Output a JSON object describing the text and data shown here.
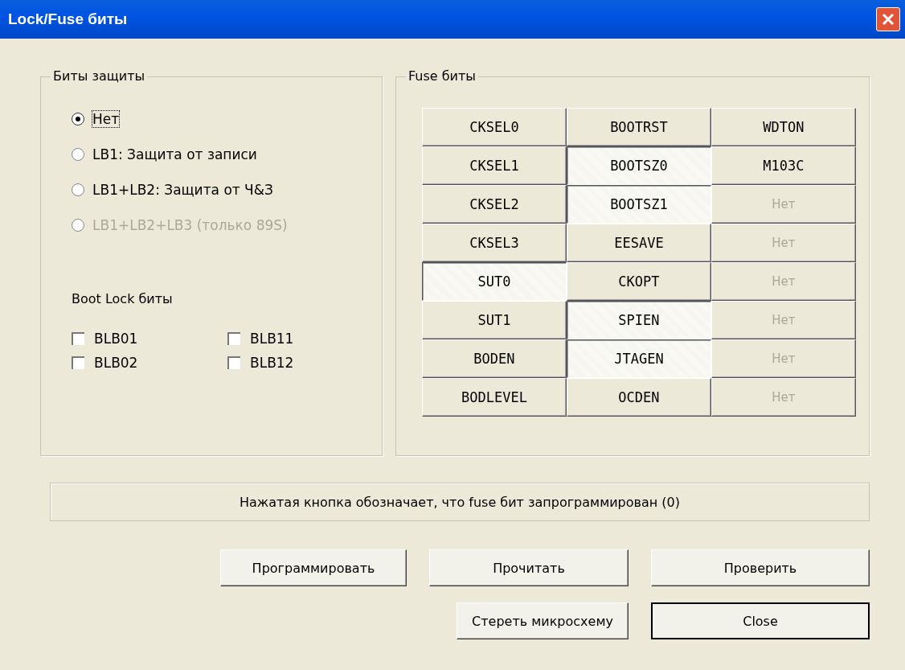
{
  "window": {
    "title": "Lock/Fuse биты"
  },
  "lock_group": {
    "title": "Биты защиты",
    "options": [
      {
        "label": "Нет",
        "selected": true,
        "disabled": false
      },
      {
        "label": "LB1: Защита от записи",
        "selected": false,
        "disabled": false
      },
      {
        "label": "LB1+LB2: Защита от Ч&З",
        "selected": false,
        "disabled": false
      },
      {
        "label": "LB1+LB2+LB3 (только 89S)",
        "selected": false,
        "disabled": true
      }
    ],
    "boot_lock_label": "Boot Lock биты",
    "boot_lock_bits": [
      {
        "label": "BLB01",
        "checked": false
      },
      {
        "label": "BLB11",
        "checked": false
      },
      {
        "label": "BLB02",
        "checked": false
      },
      {
        "label": "BLB12",
        "checked": false
      }
    ]
  },
  "fuse_group": {
    "title": "Fuse биты",
    "buttons": [
      {
        "label": "CKSEL0",
        "pressed": false,
        "disabled": false
      },
      {
        "label": "BOOTRST",
        "pressed": false,
        "disabled": false
      },
      {
        "label": "WDTON",
        "pressed": false,
        "disabled": false
      },
      {
        "label": "CKSEL1",
        "pressed": false,
        "disabled": false
      },
      {
        "label": "BOOTSZ0",
        "pressed": true,
        "disabled": false
      },
      {
        "label": "M103C",
        "pressed": false,
        "disabled": false
      },
      {
        "label": "CKSEL2",
        "pressed": false,
        "disabled": false
      },
      {
        "label": "BOOTSZ1",
        "pressed": true,
        "disabled": false
      },
      {
        "label": "Нет",
        "pressed": false,
        "disabled": true
      },
      {
        "label": "CKSEL3",
        "pressed": false,
        "disabled": false
      },
      {
        "label": "EESAVE",
        "pressed": false,
        "disabled": false
      },
      {
        "label": "Нет",
        "pressed": false,
        "disabled": true
      },
      {
        "label": "SUT0",
        "pressed": true,
        "disabled": false
      },
      {
        "label": "CKOPT",
        "pressed": false,
        "disabled": false
      },
      {
        "label": "Нет",
        "pressed": false,
        "disabled": true
      },
      {
        "label": "SUT1",
        "pressed": false,
        "disabled": false
      },
      {
        "label": "SPIEN",
        "pressed": true,
        "disabled": false
      },
      {
        "label": "Нет",
        "pressed": false,
        "disabled": true
      },
      {
        "label": "BODEN",
        "pressed": false,
        "disabled": false
      },
      {
        "label": "JTAGEN",
        "pressed": true,
        "disabled": false
      },
      {
        "label": "Нет",
        "pressed": false,
        "disabled": true
      },
      {
        "label": "BODLEVEL",
        "pressed": false,
        "disabled": false
      },
      {
        "label": "OCDEN",
        "pressed": false,
        "disabled": false
      },
      {
        "label": "Нет",
        "pressed": false,
        "disabled": true
      }
    ]
  },
  "status_text": "Нажатая кнопка обозначает, что fuse бит запрограммирован (0)",
  "buttons_row_1": [
    "Программировать",
    "Прочитать",
    "Проверить"
  ],
  "buttons_row_2": [
    "Стереть микросхему",
    "Close"
  ]
}
